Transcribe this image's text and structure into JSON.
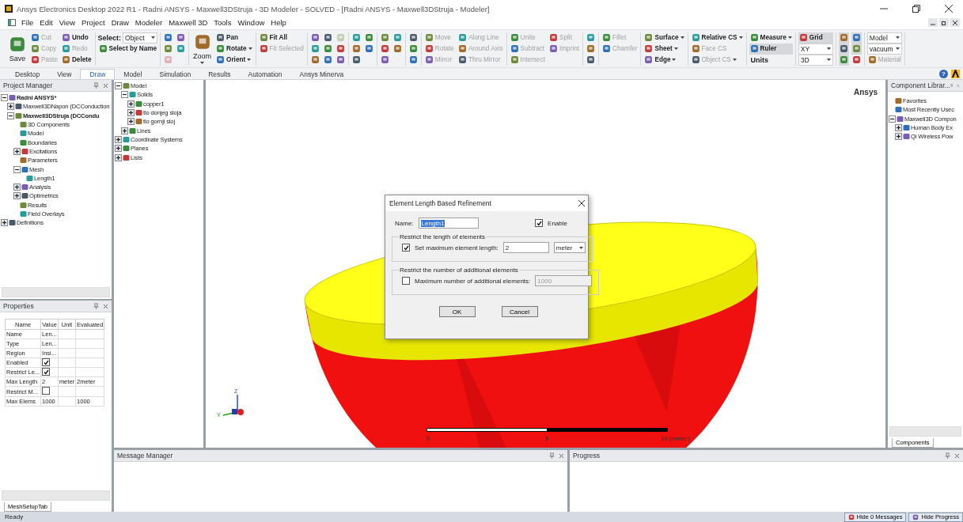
{
  "window": {
    "title": "Ansys Electronics Desktop 2022 R1 - Radni ANSYS - Maxwell3DStruja - 3D Modeler - SOLVED - [Radni ANSYS - Maxwell3DStruja - Modeler]"
  },
  "menu": [
    "File",
    "Edit",
    "View",
    "Project",
    "Draw",
    "Modeler",
    "Maxwell 3D",
    "Tools",
    "Window",
    "Help"
  ],
  "ribbon": {
    "groups": [
      {
        "items": [
          {
            "kind": "large",
            "label": "Save",
            "disabled": false
          },
          {
            "kind": "small",
            "label": "Cut",
            "disabled": true
          },
          {
            "kind": "small",
            "label": "Copy",
            "disabled": true
          },
          {
            "kind": "small",
            "label": "Paste",
            "disabled": true
          },
          {
            "kind": "small",
            "label": "Undo",
            "disabled": false
          },
          {
            "kind": "small",
            "label": "Redo",
            "disabled": true
          },
          {
            "kind": "small",
            "label": "Delete",
            "disabled": false
          }
        ]
      },
      {
        "items": [
          {
            "kind": "select",
            "label": "Select:",
            "value": "Object"
          },
          {
            "kind": "small",
            "label": "Select by Name",
            "disabled": false
          }
        ]
      },
      {
        "items": [
          {
            "kind": "icon",
            "disabled": false
          },
          {
            "kind": "icon",
            "disabled": false
          },
          {
            "kind": "icon",
            "disabled": true
          },
          {
            "kind": "icon",
            "disabled": false
          },
          {
            "kind": "icon",
            "disabled": false
          }
        ]
      },
      {
        "items": [
          {
            "kind": "large",
            "label": "Zoom",
            "disabled": false,
            "dropdown": true
          },
          {
            "kind": "small",
            "label": "Pan",
            "disabled": false
          },
          {
            "kind": "small",
            "label": "Rotate",
            "disabled": false,
            "dropdown": true
          },
          {
            "kind": "small",
            "label": "Orient",
            "disabled": false,
            "dropdown": true
          }
        ]
      },
      {
        "items": [
          {
            "kind": "small",
            "label": "Fit All",
            "disabled": false
          },
          {
            "kind": "small",
            "label": "Fit Selected",
            "disabled": true
          }
        ]
      },
      {
        "items": [
          {
            "kind": "icon",
            "disabled": false
          },
          {
            "kind": "icon",
            "disabled": false
          },
          {
            "kind": "icon",
            "disabled": false
          },
          {
            "kind": "icon",
            "disabled": false
          },
          {
            "kind": "icon",
            "disabled": false
          },
          {
            "kind": "icon",
            "disabled": false
          },
          {
            "kind": "icon",
            "disabled": true
          },
          {
            "kind": "icon",
            "disabled": false
          },
          {
            "kind": "icon",
            "disabled": false
          }
        ]
      },
      {
        "items": [
          {
            "kind": "icon",
            "disabled": false
          },
          {
            "kind": "icon",
            "disabled": false
          },
          {
            "kind": "icon",
            "disabled": false
          },
          {
            "kind": "icon",
            "disabled": false
          },
          {
            "kind": "icon",
            "disabled": false
          }
        ]
      },
      {
        "items": [
          {
            "kind": "icon",
            "disabled": false
          },
          {
            "kind": "icon",
            "disabled": false
          },
          {
            "kind": "icon",
            "disabled": false
          },
          {
            "kind": "icon",
            "disabled": false
          },
          {
            "kind": "icon",
            "disabled": false
          }
        ]
      },
      {
        "items": [
          {
            "kind": "icon",
            "disabled": false
          },
          {
            "kind": "icon",
            "disabled": false
          },
          {
            "kind": "icon",
            "disabled": false
          }
        ]
      },
      {
        "items": [
          {
            "kind": "small",
            "label": "Move",
            "disabled": true
          },
          {
            "kind": "small",
            "label": "Rotate",
            "disabled": true
          },
          {
            "kind": "small",
            "label": "Mirror",
            "disabled": true
          },
          {
            "kind": "small",
            "label": "Along Line",
            "disabled": true
          },
          {
            "kind": "small",
            "label": "Around Axis",
            "disabled": true
          },
          {
            "kind": "small",
            "label": "Thru Mirror",
            "disabled": true
          }
        ]
      },
      {
        "items": [
          {
            "kind": "small",
            "label": "Unite",
            "disabled": true
          },
          {
            "kind": "small",
            "label": "Subtract",
            "disabled": true
          },
          {
            "kind": "small",
            "label": "Intersect",
            "disabled": true
          },
          {
            "kind": "small",
            "label": "Split",
            "disabled": true
          },
          {
            "kind": "small",
            "label": "Imprint",
            "disabled": true
          }
        ]
      },
      {
        "items": [
          {
            "kind": "icon",
            "disabled": false
          },
          {
            "kind": "icon",
            "disabled": false
          },
          {
            "kind": "icon",
            "disabled": false
          }
        ]
      },
      {
        "items": [
          {
            "kind": "small",
            "label": "Fillet",
            "disabled": true
          },
          {
            "kind": "small",
            "label": "Chamfer",
            "disabled": true
          }
        ]
      },
      {
        "items": [
          {
            "kind": "small",
            "label": "Surface",
            "disabled": false,
            "dropdown": true
          },
          {
            "kind": "small",
            "label": "Sheet",
            "disabled": false,
            "dropdown": true
          },
          {
            "kind": "small",
            "label": "Edge",
            "disabled": false,
            "dropdown": true
          }
        ]
      },
      {
        "items": [
          {
            "kind": "small",
            "label": "Relative CS",
            "disabled": false,
            "dropdown": true
          },
          {
            "kind": "small",
            "label": "Face CS",
            "disabled": true
          },
          {
            "kind": "small",
            "label": "Object CS",
            "disabled": true,
            "dropdown": true
          }
        ]
      },
      {
        "items": [
          {
            "kind": "small",
            "label": "Measure",
            "disabled": false,
            "dropdown": true,
            "active": false
          },
          {
            "kind": "small",
            "label": "Ruler",
            "disabled": false,
            "active": true
          },
          {
            "kind": "text",
            "label": "Units"
          }
        ]
      },
      {
        "items": [
          {
            "kind": "small",
            "label": "Grid",
            "disabled": false,
            "active": true
          },
          {
            "kind": "select",
            "value": "XY"
          },
          {
            "kind": "select",
            "value": "3D"
          }
        ]
      },
      {
        "items": [
          {
            "kind": "icon",
            "disabled": false,
            "active": true
          },
          {
            "kind": "icon",
            "disabled": false,
            "active": true
          },
          {
            "kind": "icon",
            "disabled": false,
            "active": true
          },
          {
            "kind": "icon",
            "disabled": false,
            "active": true
          },
          {
            "kind": "icon",
            "disabled": false,
            "active": true
          },
          {
            "kind": "icon",
            "disabled": false,
            "active": false
          }
        ]
      },
      {
        "items": [
          {
            "kind": "select",
            "value": "Model"
          },
          {
            "kind": "select",
            "value": "vacuum"
          },
          {
            "kind": "small",
            "label": "Material",
            "disabled": true
          }
        ]
      }
    ]
  },
  "tabs": [
    {
      "label": "Desktop",
      "selected": false
    },
    {
      "label": "View",
      "selected": false
    },
    {
      "label": "Draw",
      "selected": true
    },
    {
      "label": "Model",
      "selected": false
    },
    {
      "label": "Simulation",
      "selected": false
    },
    {
      "label": "Results",
      "selected": false
    },
    {
      "label": "Automation",
      "selected": false
    },
    {
      "label": "Ansys Minerva",
      "selected": false
    }
  ],
  "help": "?",
  "project_manager": {
    "title": "Project Manager",
    "tree": [
      {
        "label": "Radni ANSYS*",
        "active": true,
        "expanded": true,
        "children": [
          {
            "label": "Maxwell3DNapon (DCConduction",
            "active": false,
            "expanded": false
          },
          {
            "label": "Maxwell3DStruja (DCCondu",
            "active": true,
            "expanded": true,
            "children": [
              {
                "label": "3D Components"
              },
              {
                "label": "Model"
              },
              {
                "label": "Boundaries"
              },
              {
                "label": "Excitations",
                "expanded": false
              },
              {
                "label": "Parameters"
              },
              {
                "label": "Mesh",
                "expanded": true,
                "children": [
                  {
                    "label": "Length1"
                  }
                ]
              },
              {
                "label": "Analysis",
                "expanded": false
              },
              {
                "label": "Optimetrics",
                "expanded": false
              },
              {
                "label": "Results"
              },
              {
                "label": "Field Overlays"
              }
            ]
          }
        ]
      },
      {
        "label": "Definitions",
        "expanded": false
      }
    ]
  },
  "model_tree": [
    {
      "label": "Model",
      "expanded": true,
      "children": [
        {
          "label": "Solids",
          "expanded": true,
          "children": [
            {
              "label": "copper1",
              "expanded": false
            },
            {
              "label": "tlo donjeg sloja",
              "expanded": false
            },
            {
              "label": "tlo gornji sloj",
              "expanded": false
            }
          ]
        },
        {
          "label": "Lines",
          "expanded": false
        }
      ]
    },
    {
      "label": "Coordinate Systems",
      "expanded": false
    },
    {
      "label": "Planes",
      "expanded": false
    },
    {
      "label": "Lists",
      "expanded": false
    }
  ],
  "properties": {
    "title": "Properties",
    "columns": [
      "Name",
      "Value",
      "Unit",
      "Evaluated"
    ],
    "rows": [
      {
        "kind": "text",
        "name": "Name",
        "value": "Len..."
      },
      {
        "kind": "text",
        "name": "Type",
        "value": "Len..."
      },
      {
        "kind": "text",
        "name": "Region",
        "value": "Insi..."
      },
      {
        "kind": "check",
        "name": "Enabled",
        "checked": true
      },
      {
        "kind": "check",
        "name": "Restrict Le...",
        "checked": true
      },
      {
        "kind": "text",
        "name": "Max Length",
        "value": "2",
        "unit": "meter",
        "evaluated": "2meter"
      },
      {
        "kind": "check",
        "name": "Restrict M...",
        "checked": false
      },
      {
        "kind": "text",
        "name": "Max Elems",
        "value": "1000",
        "evaluated": "1000"
      }
    ],
    "tab": "MeshSetupTab"
  },
  "viewport": {
    "brand": "Ansys",
    "axis_labels": [
      "Z",
      "Y"
    ],
    "scale_labels": [
      "0",
      "5",
      "10 (meter)"
    ]
  },
  "dialog": {
    "title": "Element Length Based Refinement",
    "name_label": "Name:",
    "name_value": "Length1",
    "enable": {
      "label": "Enable",
      "checked": true
    },
    "groups": [
      {
        "title": "Restrict the length of elements",
        "checkbox": {
          "label": "Set maximum element length:",
          "checked": true
        },
        "value": "2",
        "unit": "meter",
        "disabled": false
      },
      {
        "title": "Restrict the number of additional elements",
        "checkbox": {
          "label": "Maximum number of additional elements:",
          "checked": false
        },
        "value": "1000",
        "disabled": true
      }
    ],
    "buttons": [
      "OK",
      "Cancel"
    ]
  },
  "component_library": {
    "title": "Component Librar...",
    "tree": [
      {
        "label": "Favorites"
      },
      {
        "label": "Most Recently Usec"
      },
      {
        "label": "Maxwell3D Compon",
        "expanded": true,
        "children": [
          {
            "label": "Human Body Ex",
            "expanded": false
          },
          {
            "label": "Qi Wireless Pow",
            "expanded": false
          }
        ]
      }
    ],
    "tab": "Components"
  },
  "message_manager": {
    "title": "Message Manager"
  },
  "progress": {
    "title": "Progress"
  },
  "status_bar": {
    "text": "Ready",
    "buttons": [
      "Hide 0 Messages",
      "Hide Progress"
    ]
  }
}
